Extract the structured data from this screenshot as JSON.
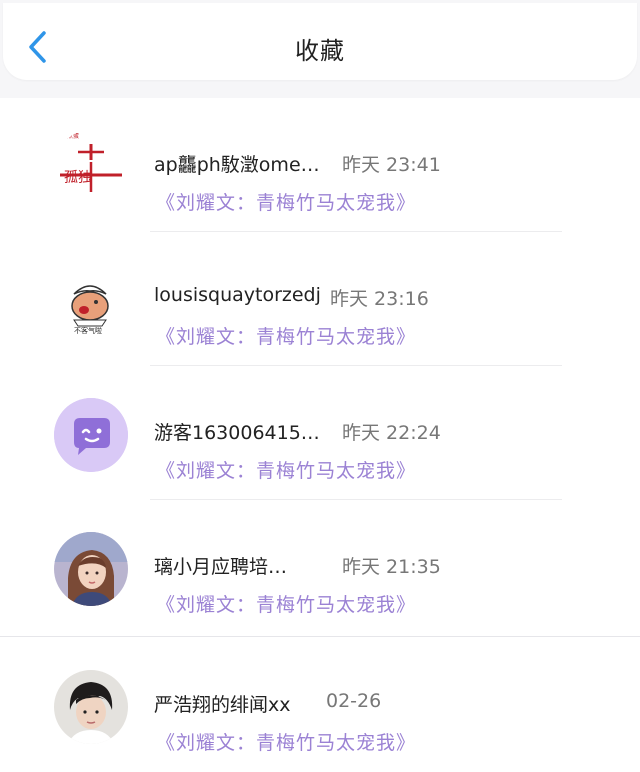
{
  "header": {
    "title": "收藏",
    "back_icon": "chevron-left-icon",
    "accent_color": "#2f95e8"
  },
  "favorites": [
    {
      "name": "ap龘ph駇澂ome…",
      "time": "昨天 23:41",
      "book": "《刘耀文：青梅竹马太宠我》",
      "avatar_text": "孤独",
      "avatar_small_text": "点点蛋"
    },
    {
      "name": "lousisquaytorzedj",
      "time": "昨天 23:16",
      "book": "《刘耀文：青梅竹马太宠我》",
      "avatar_text": "不客气啦"
    },
    {
      "name": "游客163006415…",
      "time": "昨天 22:24",
      "book": "《刘耀文：青梅竹马太宠我》"
    },
    {
      "name": "璃小月应聘培…",
      "time": "昨天 21:35",
      "book": "《刘耀文：青梅竹马太宠我》"
    },
    {
      "name": "严浩翔的绯闻xx",
      "time": "02-26",
      "book": "《刘耀文：青梅竹马太宠我》"
    }
  ],
  "colors": {
    "book_title": "#9b82d4",
    "guest_avatar_bg": "#d9c9f6",
    "guest_avatar_fg": "#8f6fd8"
  }
}
